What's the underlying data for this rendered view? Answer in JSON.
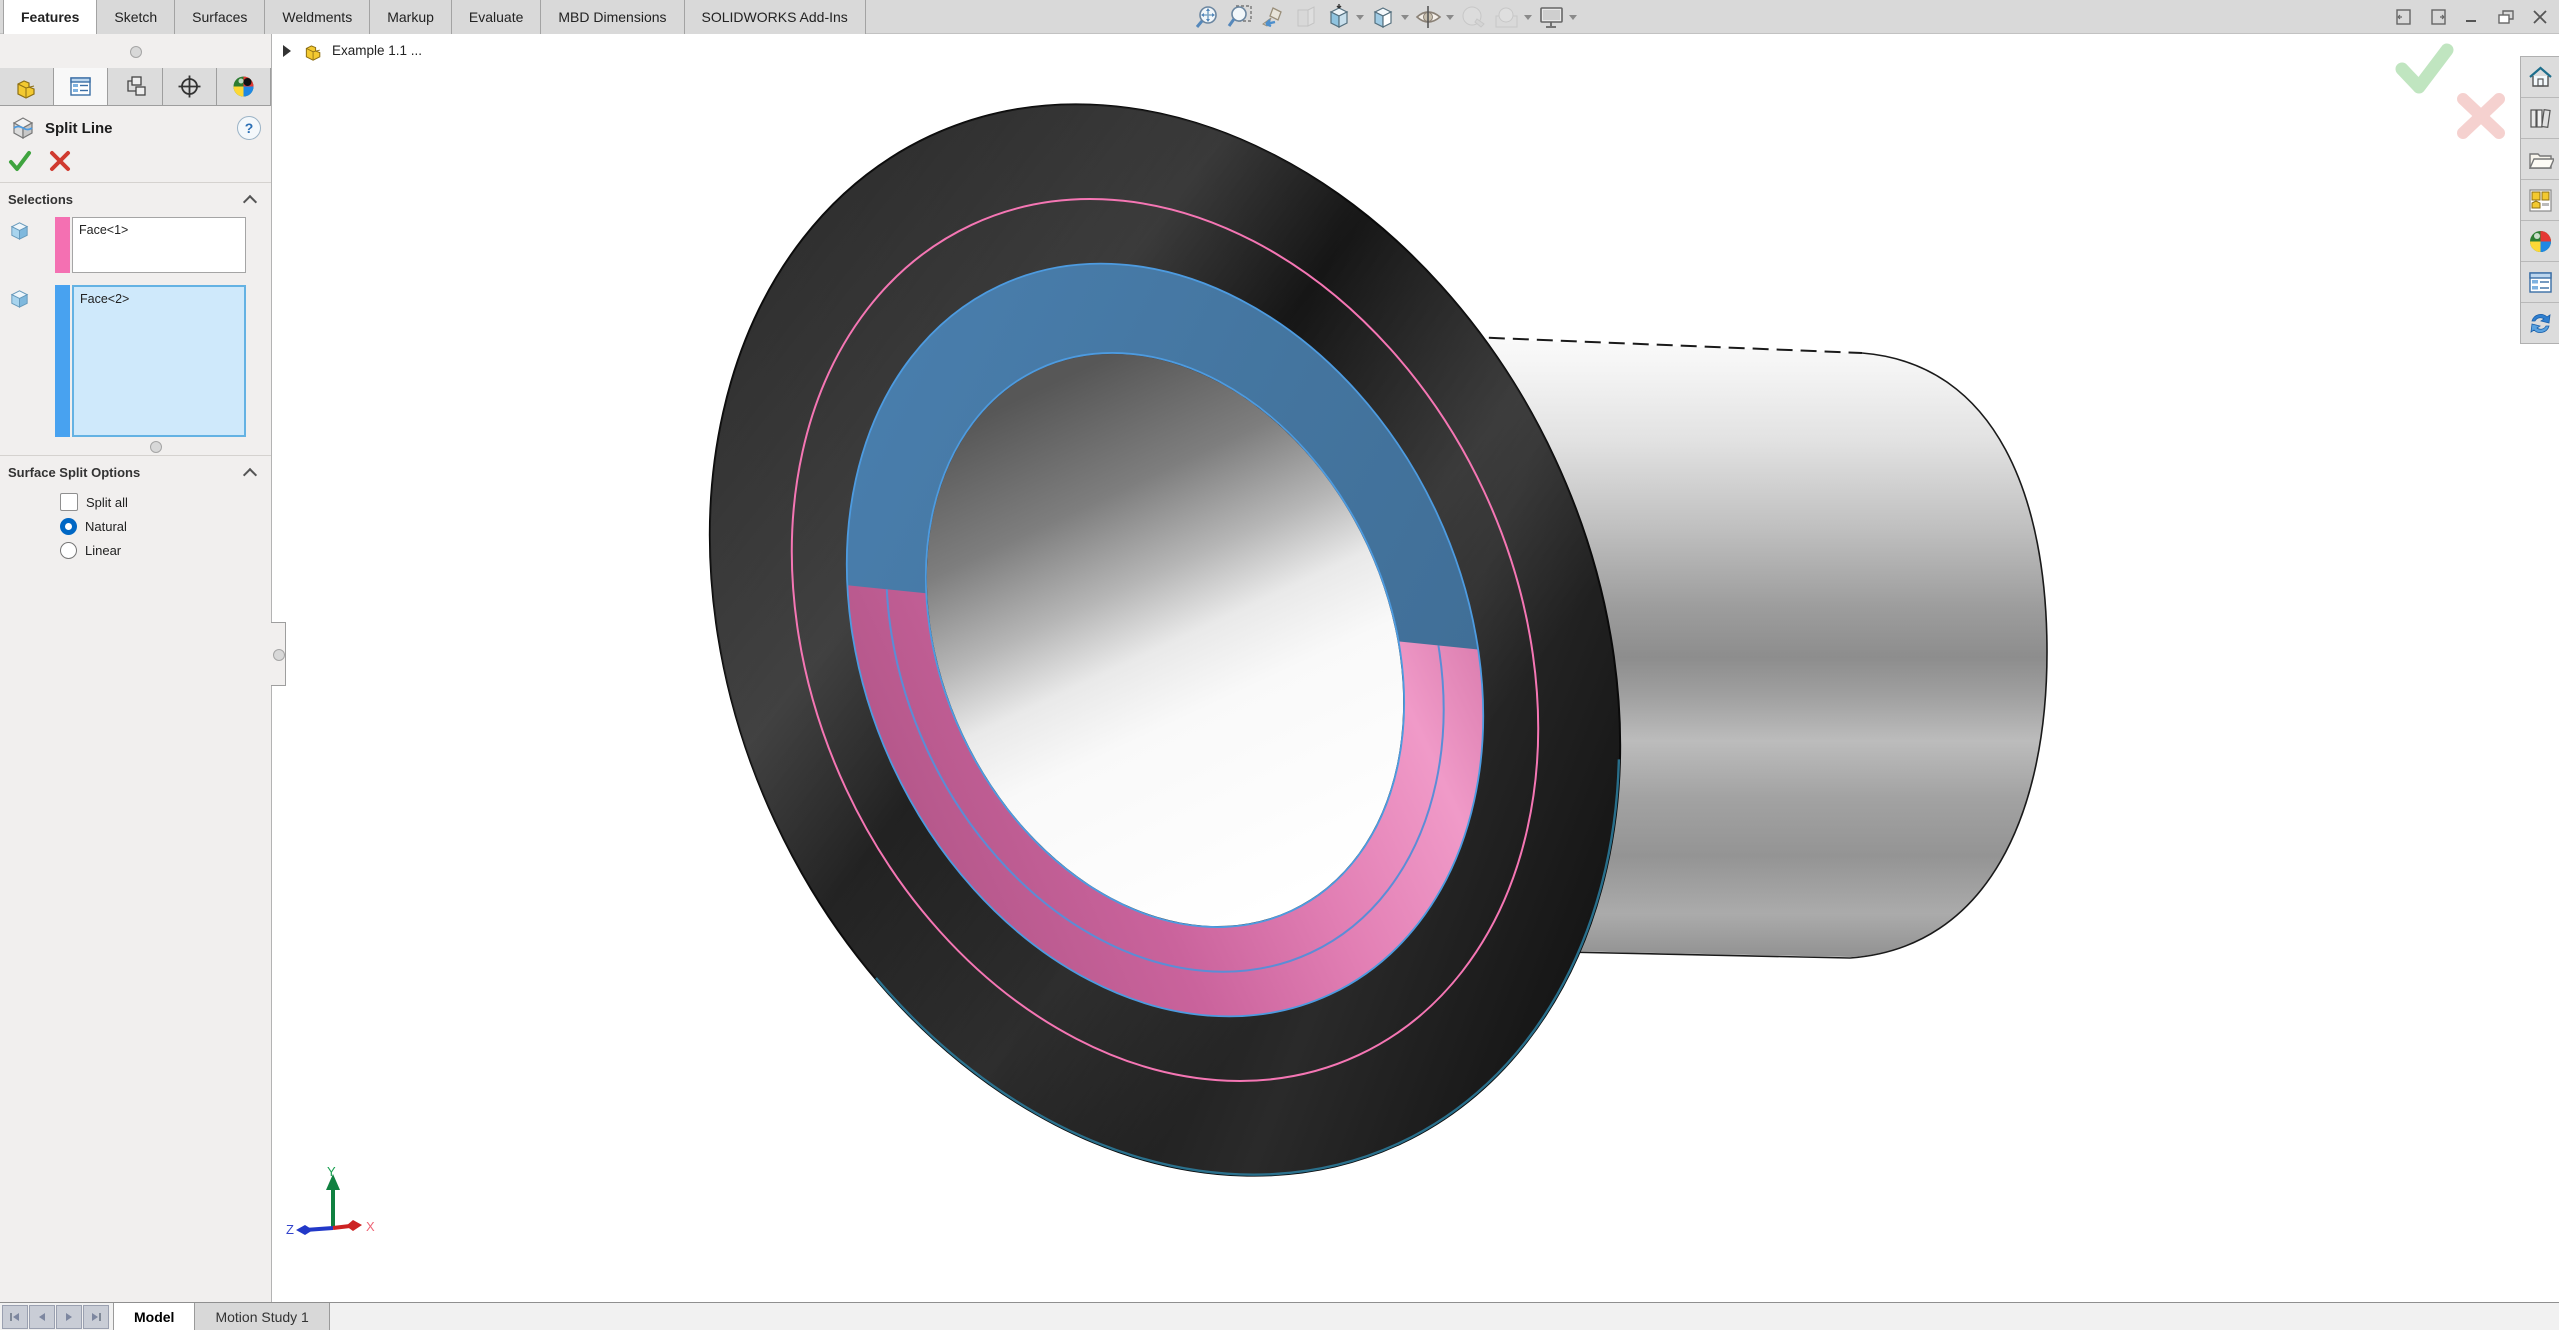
{
  "colors": {
    "accent_blue": "#0067c4",
    "selection_swatch_pink": "#f470b2",
    "selection_swatch_blue": "#48a2f0",
    "face_highlight_blue": "#44759f",
    "face_highlight_pink": "#d973aa",
    "split_edge_blue": "#4d9be0",
    "split_circle_pink": "#f576b4",
    "confirm_check_green": "#8ccf8c",
    "confirm_x_red": "#eda5a0"
  },
  "ribbon": {
    "tabs": [
      {
        "label": "Features",
        "active": true
      },
      {
        "label": "Sketch",
        "active": false
      },
      {
        "label": "Surfaces",
        "active": false
      },
      {
        "label": "Weldments",
        "active": false
      },
      {
        "label": "Markup",
        "active": false
      },
      {
        "label": "Evaluate",
        "active": false
      },
      {
        "label": "MBD Dimensions",
        "active": false
      },
      {
        "label": "SOLIDWORKS Add-Ins",
        "active": false
      }
    ]
  },
  "headsup": {
    "buttons": [
      {
        "icon": "zoom-to-fit-icon",
        "dropdown": false,
        "disabled": false
      },
      {
        "icon": "zoom-to-area-icon",
        "dropdown": false,
        "disabled": false
      },
      {
        "icon": "previous-view-icon",
        "dropdown": false,
        "disabled": false
      },
      {
        "icon": "section-view-icon",
        "dropdown": false,
        "disabled": true
      },
      {
        "icon": "view-orientation-icon",
        "dropdown": true,
        "disabled": false
      },
      {
        "icon": "display-style-icon",
        "dropdown": true,
        "disabled": false
      },
      {
        "icon": "hide-show-items-icon",
        "dropdown": true,
        "disabled": false
      },
      {
        "icon": "edit-appearance-icon",
        "dropdown": false,
        "disabled": true
      },
      {
        "icon": "apply-scene-icon",
        "dropdown": true,
        "disabled": true
      },
      {
        "icon": "view-settings-icon",
        "dropdown": true,
        "disabled": false
      }
    ]
  },
  "window_controls": [
    "previous-window",
    "next-window",
    "minimize",
    "restore",
    "close"
  ],
  "property_manager": {
    "panel_tabs": [
      "feature-manager-tab",
      "property-manager-tab",
      "configuration-manager-tab",
      "dimxpert-manager-tab",
      "display-manager-tab"
    ],
    "title": "Split Line",
    "help_label": "?",
    "selections": {
      "header": "Selections",
      "items": [
        {
          "label": "Face<1>",
          "swatch": "#f470b2",
          "active": false
        },
        {
          "label": "Face<2>",
          "swatch": "#48a2f0",
          "active": true
        }
      ]
    },
    "surface_split_options": {
      "header": "Surface Split Options",
      "checkbox": {
        "label": "Split all",
        "checked": false
      },
      "radios": [
        {
          "label": "Natural",
          "selected": true
        },
        {
          "label": "Linear",
          "selected": false
        }
      ]
    }
  },
  "feature_tree": {
    "root_label": "Example 1.1 ..."
  },
  "viewport": {
    "triad": {
      "x_label": "X",
      "y_label": "Y",
      "z_label": "Z"
    }
  },
  "task_pane": {
    "icons": [
      "home-icon",
      "design-library-icon",
      "file-explorer-icon",
      "view-palette-icon",
      "appearances-scenes-icon",
      "custom-properties-icon",
      "forum-sync-icon"
    ]
  },
  "bottom_bar": {
    "tabs": [
      {
        "label": "Model",
        "active": true
      },
      {
        "label": "Motion Study 1",
        "active": false
      }
    ]
  }
}
